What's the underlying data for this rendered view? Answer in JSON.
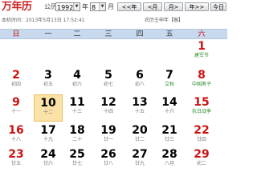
{
  "header": {
    "logo": "万年历",
    "gongli_label": "公历",
    "year_value": "1992",
    "year_label": "年",
    "month_value": "8",
    "month_label": "月",
    "prev_year": "<<年",
    "prev_month": "<月",
    "next_month": "月>",
    "next_year": "年>>",
    "today": "今日"
  },
  "info": {
    "current_time": "本机时间：2013年5月13日 17:52:41",
    "lunar_year": "农历壬申年【猴】"
  },
  "weekdays": [
    "日",
    "一",
    "二",
    "三",
    "四",
    "五",
    "六"
  ],
  "days": [
    {
      "day": "1",
      "sub": "建军节",
      "red": true,
      "green": true
    },
    {
      "day": "2",
      "sub": "初四",
      "red": true
    },
    {
      "day": "3",
      "sub": "初五"
    },
    {
      "day": "4",
      "sub": "初六"
    },
    {
      "day": "5",
      "sub": "初七"
    },
    {
      "day": "6",
      "sub": "初八"
    },
    {
      "day": "7",
      "sub": "立秋",
      "green": true
    },
    {
      "day": "8",
      "sub": "中国男子",
      "red": true,
      "green": true
    },
    {
      "day": "9",
      "sub": "十一",
      "red": true
    },
    {
      "day": "10",
      "sub": "十二",
      "today": true
    },
    {
      "day": "11",
      "sub": "十三"
    },
    {
      "day": "12",
      "sub": "十四"
    },
    {
      "day": "13",
      "sub": "十五"
    },
    {
      "day": "14",
      "sub": "十六"
    },
    {
      "day": "15",
      "sub": "抗日战争",
      "red": true,
      "green": true
    },
    {
      "day": "16",
      "sub": "十八",
      "red": true
    },
    {
      "day": "17",
      "sub": "十九"
    },
    {
      "day": "18",
      "sub": "二十"
    },
    {
      "day": "19",
      "sub": "廿一"
    },
    {
      "day": "20",
      "sub": "廿二"
    },
    {
      "day": "21",
      "sub": "廿三"
    },
    {
      "day": "22",
      "sub": "廿四",
      "red": true
    },
    {
      "day": "23",
      "sub": "廿五",
      "red": true
    },
    {
      "day": "24",
      "sub": "廿六"
    },
    {
      "day": "25",
      "sub": "廿七"
    },
    {
      "day": "26",
      "sub": "廿八"
    },
    {
      "day": "27",
      "sub": "廿九"
    },
    {
      "day": "28",
      "sub": "八月"
    },
    {
      "day": "29",
      "sub": "初二",
      "red": true
    }
  ]
}
